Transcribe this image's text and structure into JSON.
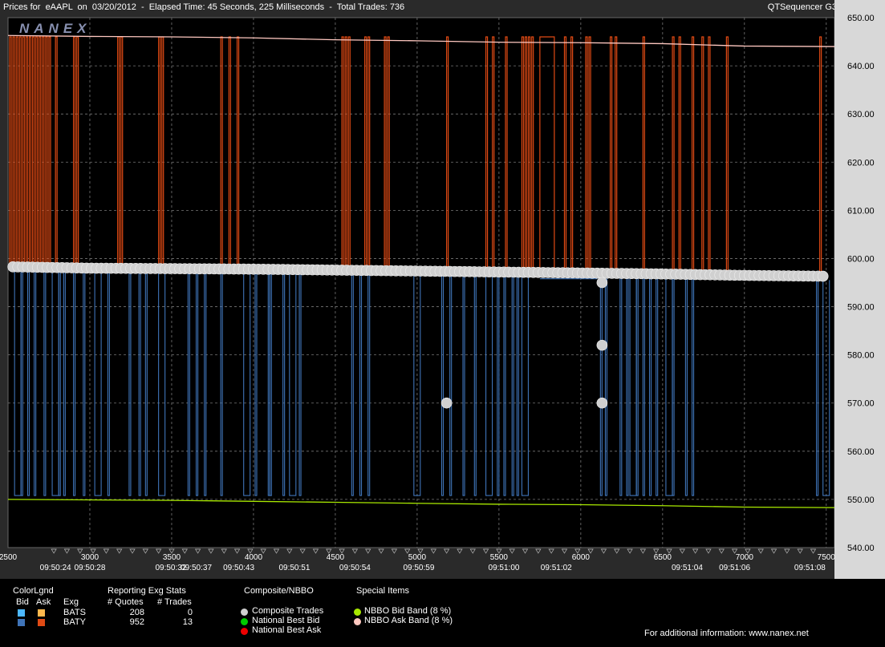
{
  "header": {
    "title": "Prices for  eAAPL  on  03/20/2012  -  Elapsed Time: 45 Seconds, 225 Milliseconds  -  Total Trades: 736",
    "app_name": "QTSequencer G3",
    "logo_text": "NANEX"
  },
  "chart_data": {
    "type": "line",
    "y_ticks": [
      "650.00",
      "640.00",
      "630.00",
      "620.00",
      "610.00",
      "600.00",
      "590.00",
      "580.00",
      "570.00",
      "560.00",
      "550.00",
      "540.00"
    ],
    "ylim": [
      540,
      650
    ],
    "x_ticks": [
      "2500",
      "3000",
      "3500",
      "4000",
      "4500",
      "5000",
      "5500",
      "6000",
      "6500",
      "7000",
      "7500"
    ],
    "xlim": [
      2500,
      7550
    ],
    "time_labels": [
      {
        "x": 2790,
        "t": "09:50:24"
      },
      {
        "x": 3000,
        "t": "09:50:28"
      },
      {
        "x": 3495,
        "t": "09:50:32"
      },
      {
        "x": 3650,
        "t": "09:50:37"
      },
      {
        "x": 3910,
        "t": "09:50:43"
      },
      {
        "x": 4250,
        "t": "09:50:51"
      },
      {
        "x": 4620,
        "t": "09:50:54"
      },
      {
        "x": 5010,
        "t": "09:50:59"
      },
      {
        "x": 5530,
        "t": "09:51:00"
      },
      {
        "x": 5850,
        "t": "09:51:02"
      },
      {
        "x": 6650,
        "t": "09:51:04"
      },
      {
        "x": 6940,
        "t": "09:51:06"
      },
      {
        "x": 7400,
        "t": "09:51:08"
      }
    ],
    "grid": true,
    "series": [
      {
        "name": "NBBO Ask Band (8 %)",
        "color": "#ffc8c0",
        "points": [
          [
            2500,
            646.3
          ],
          [
            3000,
            646.1
          ],
          [
            3500,
            646.0
          ],
          [
            4000,
            645.8
          ],
          [
            4500,
            645.4
          ],
          [
            5000,
            645.2
          ],
          [
            5500,
            644.9
          ],
          [
            6000,
            644.8
          ],
          [
            6500,
            644.6
          ],
          [
            7000,
            644.1
          ],
          [
            7550,
            644.0
          ]
        ]
      },
      {
        "name": "NBBO Bid Band (8 %)",
        "color": "#a8e800",
        "points": [
          [
            2500,
            550.0
          ],
          [
            3000,
            549.9
          ],
          [
            3500,
            549.8
          ],
          [
            4000,
            549.6
          ],
          [
            4500,
            549.4
          ],
          [
            5000,
            549.2
          ],
          [
            5500,
            549.0
          ],
          [
            6000,
            548.9
          ],
          [
            6500,
            548.7
          ],
          [
            7000,
            548.4
          ],
          [
            7550,
            548.3
          ]
        ]
      },
      {
        "name": "Composite Trades",
        "color": "#d0d0d0",
        "points": [
          [
            2500,
            598.3
          ],
          [
            3000,
            598.0
          ],
          [
            3500,
            597.9
          ],
          [
            4000,
            597.8
          ],
          [
            4500,
            597.6
          ],
          [
            5000,
            597.4
          ],
          [
            5500,
            597.2
          ],
          [
            6000,
            597.0
          ],
          [
            6500,
            596.8
          ],
          [
            7000,
            596.5
          ],
          [
            7550,
            596.3
          ]
        ]
      }
    ],
    "outlier_trades": [
      [
        5180,
        570.0
      ],
      [
        6130,
        595.0
      ],
      [
        6130,
        582.0
      ],
      [
        6130,
        570.0
      ]
    ],
    "baty_ask_spikes_x": [
      2510,
      2530,
      2550,
      2570,
      2590,
      2610,
      2630,
      2650,
      2670,
      2690,
      2710,
      2730,
      2750,
      2790,
      2900,
      2920,
      3170,
      3190,
      3420,
      3440,
      3800,
      3850,
      3900,
      4540,
      4560,
      4580,
      4680,
      4700,
      4800,
      4820,
      5180,
      5420,
      5460,
      5540,
      5640,
      5660,
      5680,
      5700,
      5900,
      5940,
      6030,
      6050,
      6180,
      6210,
      6380,
      6560,
      6600,
      6680,
      6740,
      6780,
      6890,
      7460
    ],
    "baty_bid_dips_x": [
      2540,
      2580,
      2620,
      2660,
      2720,
      2770,
      2810,
      2840,
      2900,
      2960,
      3030,
      3110,
      3240,
      3300,
      3340,
      3420,
      3600,
      3650,
      3700,
      3800,
      3940,
      4010,
      4090,
      4100,
      4180,
      4220,
      4280,
      4600,
      4650,
      4700,
      4980,
      5150,
      5200,
      5280,
      5350,
      5420,
      5490,
      5530,
      5580,
      5610,
      5640,
      6120,
      6150,
      6240,
      6280,
      6300,
      6340,
      6380,
      6420,
      6460,
      6520,
      6560,
      6640,
      6680,
      7440,
      7480
    ],
    "bats_ask_spike": {
      "x": 5750,
      "y": 646.0
    },
    "bats_bid_level": {
      "from": 5750,
      "to": 6100,
      "y": 595.8
    }
  },
  "legend": {
    "color_legend": "ColorLgnd",
    "bid_header": "Bid",
    "ask_header": "Ask",
    "exg_header": "Exg",
    "reporting_header": "Reporting Exg Stats",
    "quotes_header": "# Quotes",
    "trades_header": "# Trades",
    "exchanges": [
      {
        "name": "BATS",
        "quotes": "208",
        "trades": "0",
        "bid_color": "#4db8ff",
        "ask_color": "#ffb84d"
      },
      {
        "name": "BATY",
        "quotes": "952",
        "trades": "13",
        "bid_color": "#3f74b8",
        "ask_color": "#e04a14"
      }
    ],
    "composite_header": "Composite/NBBO",
    "composite_items": [
      {
        "label": "Composite Trades",
        "color": "#d0d0d0"
      },
      {
        "label": "National Best Bid",
        "color": "#00cc00"
      },
      {
        "label": "National Best Ask",
        "color": "#ee0000"
      }
    ],
    "special_header": "Special Items",
    "special_items": [
      {
        "label": "NBBO Bid Band (8 %)",
        "color": "#a8e800"
      },
      {
        "label": "NBBO Ask Band (8 %)",
        "color": "#ffc8c0"
      }
    ],
    "info": "For additional information: www.nanex.net"
  }
}
